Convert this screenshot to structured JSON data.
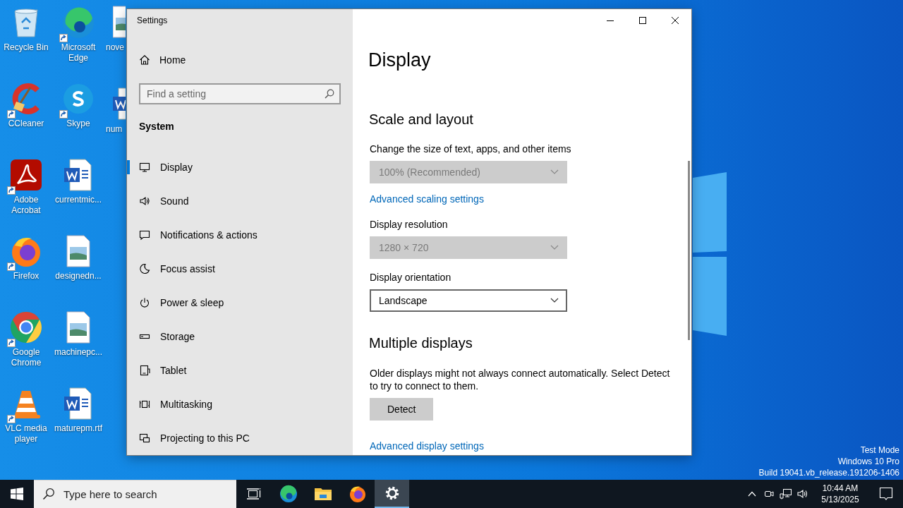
{
  "desktop": {
    "columns": [
      {
        "icons": [
          {
            "label": "Recycle Bin",
            "kind": "recycle-bin",
            "shortcut": false
          },
          {
            "label": "CCleaner",
            "kind": "ccleaner",
            "shortcut": true
          },
          {
            "label": "Adobe Acrobat",
            "kind": "acrobat",
            "shortcut": true
          },
          {
            "label": "Firefox",
            "kind": "firefox",
            "shortcut": true
          },
          {
            "label": "Google Chrome",
            "kind": "chrome",
            "shortcut": true
          },
          {
            "label": "VLC media player",
            "kind": "vlc",
            "shortcut": true
          }
        ]
      },
      {
        "icons": [
          {
            "label": "Microsoft Edge",
            "kind": "edge",
            "shortcut": true
          },
          {
            "label": "Skype",
            "kind": "skype",
            "shortcut": true
          },
          {
            "label": "currentmic...",
            "kind": "word",
            "shortcut": false
          },
          {
            "label": "designedn...",
            "kind": "image",
            "shortcut": false
          },
          {
            "label": "machinepc...",
            "kind": "image",
            "shortcut": false
          },
          {
            "label": "maturepm.rtf",
            "kind": "word",
            "shortcut": false
          }
        ]
      },
      {
        "icons": [
          {
            "label": "nove",
            "kind": "image",
            "shortcut": false
          },
          {
            "label": "num",
            "kind": "word",
            "shortcut": false
          }
        ]
      }
    ],
    "system_text": [
      "Test Mode",
      "Windows 10 Pro",
      "Build 19041.vb_release.191206-1406"
    ]
  },
  "window": {
    "title": "Settings",
    "sidebar": {
      "home": "Home",
      "search": {
        "placeholder": "Find a setting"
      },
      "section": "System",
      "items": [
        {
          "label": "Display",
          "kind": "display",
          "selected": true
        },
        {
          "label": "Sound",
          "kind": "sound",
          "selected": false
        },
        {
          "label": "Notifications & actions",
          "kind": "notifications",
          "selected": false
        },
        {
          "label": "Focus assist",
          "kind": "focus",
          "selected": false
        },
        {
          "label": "Power & sleep",
          "kind": "power",
          "selected": false
        },
        {
          "label": "Storage",
          "kind": "storage",
          "selected": false
        },
        {
          "label": "Tablet",
          "kind": "tablet",
          "selected": false
        },
        {
          "label": "Multitasking",
          "kind": "multitasking",
          "selected": false
        },
        {
          "label": "Projecting to this PC",
          "kind": "projecting",
          "selected": false
        }
      ]
    },
    "page": {
      "title": "Display",
      "content": [
        {
          "kind": "heading",
          "text": "Scale and layout"
        },
        {
          "kind": "label",
          "text": "Change the size of text, apps, and other items"
        },
        {
          "kind": "dropdown",
          "value": "100% (Recommended)",
          "disabled": true
        },
        {
          "kind": "link",
          "text": "Advanced scaling settings"
        },
        {
          "kind": "label",
          "text": "Display resolution"
        },
        {
          "kind": "dropdown",
          "value": "1280 × 720",
          "disabled": true
        },
        {
          "kind": "label",
          "text": "Display orientation"
        },
        {
          "kind": "dropdown",
          "value": "Landscape",
          "disabled": false
        },
        {
          "kind": "heading",
          "text": "Multiple displays"
        },
        {
          "kind": "paragraph",
          "text": "Older displays might not always connect automatically. Select Detect to try to connect to them."
        },
        {
          "kind": "button",
          "text": "Detect"
        },
        {
          "kind": "link",
          "text": "Advanced display settings"
        }
      ]
    }
  },
  "taskbar": {
    "search": {
      "placeholder": "Type here to search"
    },
    "apps": [
      {
        "kind": "task-view",
        "selected": false
      },
      {
        "kind": "edge",
        "selected": false
      },
      {
        "kind": "explorer",
        "selected": false
      },
      {
        "kind": "firefox",
        "selected": false
      },
      {
        "kind": "settings",
        "selected": true
      }
    ],
    "tray": {
      "time": "10:44 AM",
      "date": "5/13/2025"
    }
  }
}
